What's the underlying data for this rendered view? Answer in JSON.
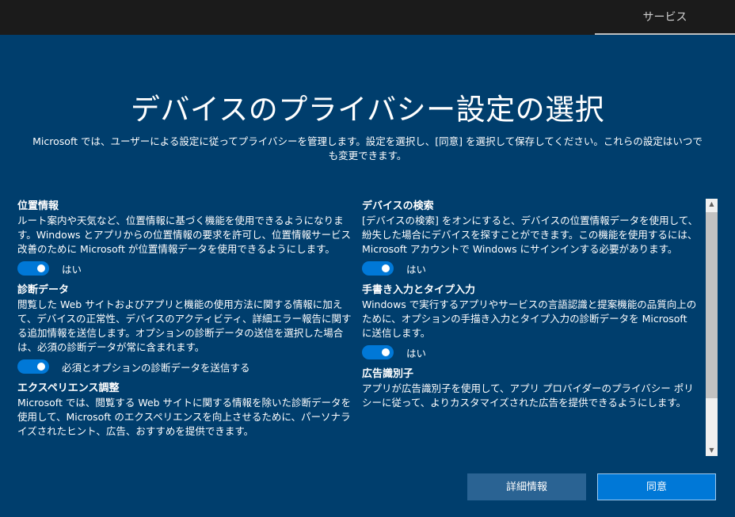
{
  "header": {
    "tab_label": "サービス"
  },
  "title": "デバイスのプライバシー設定の選択",
  "subtitle": "Microsoft では、ユーザーによる設定に従ってプライバシーを管理します。設定を選択し、[同意] を選択して保存してください。これらの設定はいつでも変更できます。",
  "settings": {
    "location": {
      "title": "位置情報",
      "desc": "ルート案内や天気など、位置情報に基づく機能を使用できるようになります。Windows とアプリからの位置情報の要求を許可し、位置情報サービス改善のために Microsoft が位置情報データを使用できるようにします。",
      "toggle_label": "はい",
      "on": true
    },
    "diagnostics": {
      "title": "診断データ",
      "desc": "閲覧した Web サイトおよびアプリと機能の使用方法に関する情報に加えて、デバイスの正常性、デバイスのアクティビティ、詳細エラー報告に関する追加情報を送信します。オプションの診断データの送信を選択した場合は、必須の診断データが常に含まれます。",
      "toggle_label": "必須とオプションの診断データを送信する",
      "on": true
    },
    "experience": {
      "title": "エクスペリエンス調整",
      "desc": "Microsoft では、閲覧する Web サイトに関する情報を除いた診断データを使用して、Microsoft のエクスペリエンスを向上させるために、パーソナライズされたヒント、広告、おすすめを提供できます。"
    },
    "find_device": {
      "title": "デバイスの検索",
      "desc": "[デバイスの検索] をオンにすると、デバイスの位置情報データを使用して、紛失した場合にデバイスを探すことができます。この機能を使用するには、Microsoft アカウントで Windows にサインインする必要があります。",
      "toggle_label": "はい",
      "on": true
    },
    "inking": {
      "title": "手書き入力とタイプ入力",
      "desc": "Windows で実行するアプリやサービスの言語認識と提案機能の品質向上のために、オプションの手描き入力とタイプ入力の診断データを Microsoft に送信します。",
      "toggle_label": "はい",
      "on": true
    },
    "ad_id": {
      "title": "広告識別子",
      "desc": "アプリが広告識別子を使用して、アプリ プロバイダーのプライバシー ポリシーに従って、よりカスタマイズされた広告を提供できるようにします。"
    }
  },
  "buttons": {
    "details": "詳細情報",
    "agree": "同意"
  },
  "colors": {
    "background": "#003e6d",
    "accent": "#0078d7",
    "topbar": "#1b1b1b"
  }
}
